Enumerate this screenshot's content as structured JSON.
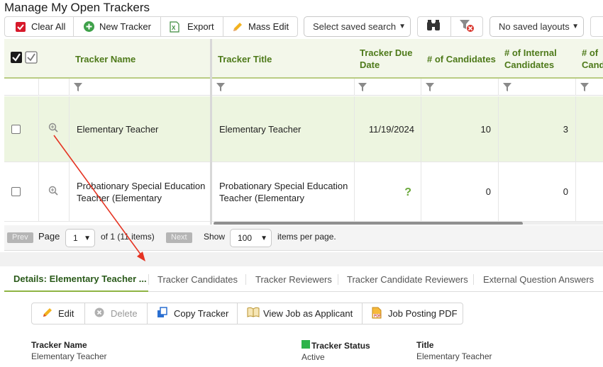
{
  "page": {
    "title": "Manage My Open Trackers"
  },
  "toolbar": {
    "clear_all": "Clear All",
    "new_tracker": "New Tracker",
    "export": "Export",
    "mass_edit": "Mass Edit",
    "saved_search_placeholder": "Select saved search",
    "layouts": "No saved layouts"
  },
  "grid": {
    "columns": [
      "Tracker Name",
      "Tracker Title",
      "Tracker Due Date",
      "# of Candidates",
      "# of Internal Candidates",
      "# of Cand"
    ],
    "rows": [
      {
        "name": "Elementary Teacher",
        "title": "Elementary Teacher",
        "due": "11/19/2024",
        "candidates": "10",
        "internal": "3"
      },
      {
        "name": "Probationary Special Education Teacher (Elementary",
        "title": "Probationary Special Education Teacher (Elementary",
        "due": "?",
        "candidates": "0",
        "internal": "0"
      }
    ]
  },
  "pager": {
    "prev": "Prev",
    "page_label": "Page",
    "page_value": "1",
    "of_text": "of 1 (11 items)",
    "next": "Next",
    "show": "Show",
    "per_page_value": "100",
    "per_page_text": "items per page."
  },
  "tabs": [
    "Details: Elementary Teacher ...",
    "Tracker Candidates",
    "Tracker Reviewers",
    "Tracker Candidate Reviewers",
    "External Question Answers"
  ],
  "details": {
    "toolbar": {
      "edit": "Edit",
      "delete": "Delete",
      "copy": "Copy Tracker",
      "view_job": "View Job as Applicant",
      "pdf": "Job Posting PDF"
    },
    "fields": {
      "name_label": "Tracker Name",
      "name_value": "Elementary Teacher",
      "status_label": "Tracker Status",
      "status_value": "Active",
      "title_label": "Title",
      "title_value": "Elementary Teacher"
    }
  },
  "colors": {
    "accent_green": "#4e7a1a",
    "status_green": "#2db34a",
    "clear_red": "#d7192b",
    "annotation_red": "#e53322"
  }
}
